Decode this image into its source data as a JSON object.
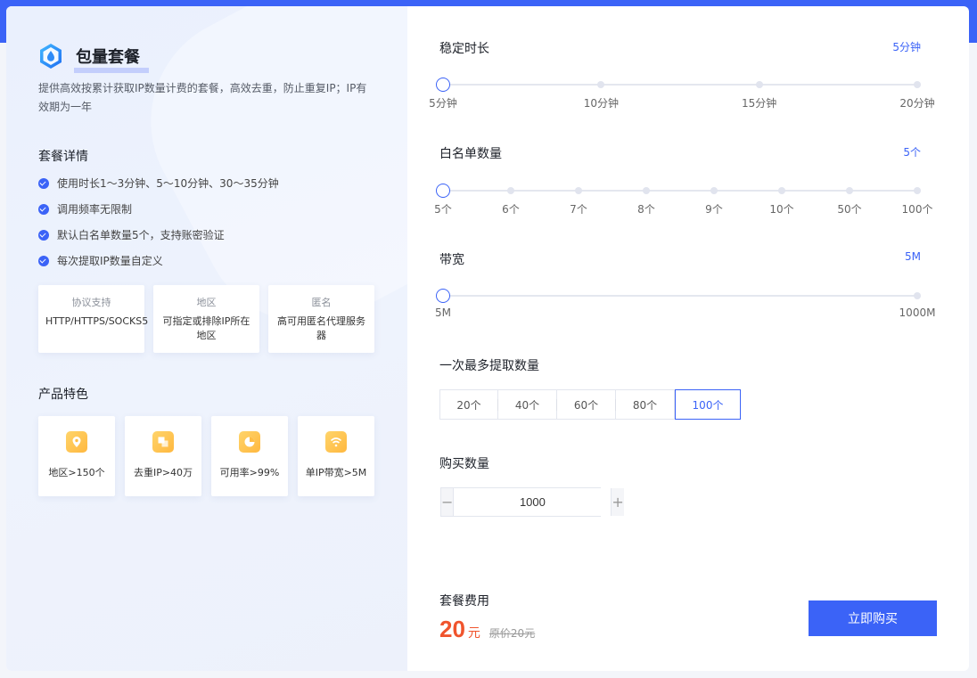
{
  "package": {
    "title": "包量套餐",
    "description": "提供高效按累计获取IP数量计费的套餐，高效去重，防止重复IP；IP有效期为一年",
    "details_heading": "套餐详情",
    "details": [
      "使用时长1～3分钟、5～10分钟、30～35分钟",
      "调用频率无限制",
      "默认白名单数量5个，支持账密验证",
      "每次提取IP数量自定义"
    ],
    "info_cards": [
      {
        "title": "协议支持",
        "text": "HTTP/HTTPS/SOCKS5"
      },
      {
        "title": "地区",
        "text": "可指定或排除IP所在地区"
      },
      {
        "title": "匿名",
        "text": "高可用匿名代理服务器"
      }
    ],
    "features_heading": "产品特色",
    "features": [
      {
        "icon": "location-icon",
        "label": "地区>150个"
      },
      {
        "icon": "dedupe-icon",
        "label": "去重IP>40万"
      },
      {
        "icon": "pie-chart-icon",
        "label": "可用率>99%"
      },
      {
        "icon": "wifi-icon",
        "label": "单IP带宽>5M"
      }
    ]
  },
  "duration": {
    "label": "稳定时长",
    "value": "5分钟",
    "selected_index": 0,
    "ticks": [
      "5分钟",
      "10分钟",
      "15分钟",
      "20分钟"
    ]
  },
  "whitelist": {
    "label": "白名单数量",
    "value": "5个",
    "selected_index": 0,
    "ticks": [
      "5个",
      "6个",
      "7个",
      "8个",
      "9个",
      "10个",
      "50个",
      "100个"
    ]
  },
  "bandwidth": {
    "label": "带宽",
    "value": "5M",
    "selected_index": 0,
    "ticks": [
      "5M",
      "1000M"
    ]
  },
  "extract": {
    "label": "一次最多提取数量",
    "selected_index": 4,
    "options": [
      "20个",
      "40个",
      "60个",
      "80个",
      "100个"
    ]
  },
  "purchase": {
    "label": "购买数量",
    "quantity": "1000",
    "minus": "−",
    "plus": "+"
  },
  "price": {
    "label": "套餐费用",
    "amount": "20",
    "unit": "元",
    "original": "原价20元",
    "buy_label": "立即购买"
  },
  "colors": {
    "accent": "#3b63f7",
    "price": "#f0542d",
    "feature_icon": "#ffc24f"
  }
}
